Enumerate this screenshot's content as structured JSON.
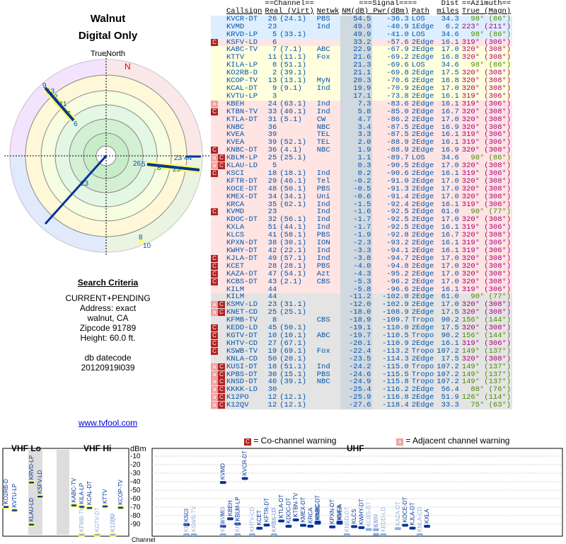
{
  "title": "Walnut",
  "subtitle": "Digital Only",
  "north_label": "TrueNorth",
  "magnetic_label": "N",
  "criteria": {
    "heading": "Search Criteria",
    "lines": [
      "CURRENT+PENDING",
      "Address: exact",
      "walnut, CA",
      "Zipcode 91789",
      "Height: 60.0 ft.",
      "",
      "db datecode",
      "20120919l039"
    ]
  },
  "site_link": "www.tvfool.com",
  "table": {
    "header1": [
      "",
      "==Channel==",
      "",
      "===Signal====",
      "",
      "Dist",
      "==Azimuth=="
    ],
    "header2": [
      "Callsign",
      "Real (Virt)",
      "Netwk",
      "NM(dB) Pwr(dBm)",
      "Path",
      "miles",
      "True (Magn)"
    ],
    "rows": [
      {
        "m": "",
        "cs": "KVCR-DT",
        "rc": "26",
        "vc": "(24.1)",
        "net": "PBS",
        "nm": "54.5",
        "pwr": "-36.3",
        "path": "LOS",
        "dist": "34.3",
        "az": "98° (86°)",
        "bg": "#ddeeff",
        "azc": "green"
      },
      {
        "m": "",
        "cs": "KVMD",
        "rc": "23",
        "vc": "",
        "net": "Ind",
        "nm": "49.9",
        "pwr": "-40.9",
        "path": "1Edge",
        "dist": "6.2",
        "az": "223° (211°)",
        "bg": "#ddeeff",
        "azc": "purple"
      },
      {
        "m": "",
        "cs": "KRVD-LP",
        "rc": "5",
        "vc": "(33.1)",
        "net": "",
        "nm": "49.9",
        "pwr": "-41.0",
        "path": "LOS",
        "dist": "34.6",
        "az": "98° (86°)",
        "bg": "#ddeeff",
        "azc": "green"
      },
      {
        "m": "C",
        "cs": "KSFV-LD",
        "rc": "6",
        "vc": "",
        "net": "",
        "nm": "33.2",
        "pwr": "-57.6",
        "path": "2Edge",
        "dist": "16.1",
        "az": "319° (306°)",
        "bg": "#ffe4e4",
        "azc": "purple"
      },
      {
        "m": "",
        "cs": "KABC-TV",
        "rc": "7",
        "vc": "(7.1)",
        "net": "ABC",
        "nm": "22.9",
        "pwr": "-67.9",
        "path": "2Edge",
        "dist": "17.0",
        "az": "320° (308°)",
        "bg": "#ffffdd",
        "azc": "purple"
      },
      {
        "m": "",
        "cs": "KTTV",
        "rc": "11",
        "vc": "(11.1)",
        "net": "Fox",
        "nm": "21.6",
        "pwr": "-69.2",
        "path": "2Edge",
        "dist": "16.8",
        "az": "320° (308°)",
        "bg": "#ffffdd",
        "azc": "purple"
      },
      {
        "m": "",
        "cs": "KILA-LP",
        "rc": "8",
        "vc": "(51.1)",
        "net": "",
        "nm": "21.3",
        "pwr": "-69.6",
        "path": "LOS",
        "dist": "34.6",
        "az": "98° (86°)",
        "bg": "#ffffdd",
        "azc": "green"
      },
      {
        "m": "",
        "cs": "KO2RB-D",
        "rc": "2",
        "vc": "(39.1)",
        "net": "",
        "nm": "21.1",
        "pwr": "-69.8",
        "path": "2Edge",
        "dist": "17.5",
        "az": "320° (308°)",
        "bg": "#ffffdd",
        "azc": "purple"
      },
      {
        "m": "",
        "cs": "KCOP-TV",
        "rc": "13",
        "vc": "(13.1)",
        "net": "MyN",
        "nm": "20.3",
        "pwr": "-70.6",
        "path": "2Edge",
        "dist": "16.8",
        "az": "320° (308°)",
        "bg": "#ffffdd",
        "azc": "purple"
      },
      {
        "m": "",
        "cs": "KCAL-DT",
        "rc": "9",
        "vc": "(9.1)",
        "net": "Ind",
        "nm": "19.9",
        "pwr": "-70.9",
        "path": "2Edge",
        "dist": "17.0",
        "az": "320° (308°)",
        "bg": "#ffffdd",
        "azc": "purple"
      },
      {
        "m": "",
        "cs": "KVTU-LP",
        "rc": "3",
        "vc": "",
        "net": "",
        "nm": "17.1",
        "pwr": "-73.8",
        "path": "2Edge",
        "dist": "16.1",
        "az": "319° (306°)",
        "bg": "#ffffdd",
        "azc": "purple"
      },
      {
        "m": "a",
        "cs": "KBEH",
        "rc": "24",
        "vc": "(63.1)",
        "net": "Ind",
        "nm": "7.3",
        "pwr": "-83.6",
        "path": "2Edge",
        "dist": "16.1",
        "az": "319° (306°)",
        "bg": "#ffe4e4",
        "azc": "purple"
      },
      {
        "m": "C",
        "cs": "KTBN-TV",
        "rc": "33",
        "vc": "(40.1)",
        "net": "Ind",
        "nm": "5.8",
        "pwr": "-85.0",
        "path": "2Edge",
        "dist": "16.7",
        "az": "320° (308°)",
        "bg": "#ffe4e4",
        "azc": "purple"
      },
      {
        "m": "",
        "cs": "KTLA-DT",
        "rc": "31",
        "vc": "(5.1)",
        "net": "CW",
        "nm": "4.7",
        "pwr": "-86.2",
        "path": "2Edge",
        "dist": "17.0",
        "az": "320° (308°)",
        "bg": "#ffe4e4",
        "azc": "purple"
      },
      {
        "m": "",
        "cs": "KNBC",
        "rc": "36",
        "vc": "",
        "net": "NBC",
        "nm": "3.4",
        "pwr": "-87.5",
        "path": "2Edge",
        "dist": "16.9",
        "az": "320° (308°)",
        "bg": "#ffe4e4",
        "azc": "purple"
      },
      {
        "m": "",
        "cs": "KVEA",
        "rc": "39",
        "vc": "",
        "net": "TEL",
        "nm": "3.3",
        "pwr": "-87.5",
        "path": "2Edge",
        "dist": "16.1",
        "az": "319° (306°)",
        "bg": "#ffe4e4",
        "azc": "purple"
      },
      {
        "m": "",
        "cs": "KVEA",
        "rc": "39",
        "vc": "(52.1)",
        "net": "TEL",
        "nm": "2.0",
        "pwr": "-88.9",
        "path": "2Edge",
        "dist": "16.1",
        "az": "319° (306°)",
        "bg": "#ffe4e4",
        "azc": "purple"
      },
      {
        "m": "C",
        "cs": "KNBC-DT",
        "rc": "36",
        "vc": "(4.1)",
        "net": "NBC",
        "nm": "1.9",
        "pwr": "-88.9",
        "path": "2Edge",
        "dist": "16.9",
        "az": "320° (308°)",
        "bg": "#ffe4e4",
        "azc": "purple"
      },
      {
        "m": "aC",
        "cs": "KBLM-LP",
        "rc": "25",
        "vc": "(25.1)",
        "net": "",
        "nm": "1.1",
        "pwr": "-89.7",
        "path": "LOS",
        "dist": "34.6",
        "az": "98° (86°)",
        "bg": "#ffe4e4",
        "azc": "green"
      },
      {
        "m": "aC",
        "cs": "KLAU-LD",
        "rc": "5",
        "vc": "",
        "net": "",
        "nm": "0.3",
        "pwr": "-90.5",
        "path": "2Edge",
        "dist": "17.0",
        "az": "320° (308°)",
        "bg": "#ffe4e4",
        "azc": "purple"
      },
      {
        "m": "C",
        "cs": "KSCI",
        "rc": "18",
        "vc": "(18.1)",
        "net": "Ind",
        "nm": "0.2",
        "pwr": "-90.6",
        "path": "2Edge",
        "dist": "16.1",
        "az": "319° (306°)",
        "bg": "#ffe4e4",
        "azc": "purple"
      },
      {
        "m": "",
        "cs": "KFTR-DT",
        "rc": "29",
        "vc": "(46.1)",
        "net": "Tel",
        "nm": "-0.2",
        "pwr": "-91.0",
        "path": "2Edge",
        "dist": "17.0",
        "az": "320° (308°)",
        "bg": "#ffe4e4",
        "azc": "purple"
      },
      {
        "m": "",
        "cs": "KOCE-DT",
        "rc": "48",
        "vc": "(50.1)",
        "net": "PBS",
        "nm": "-0.5",
        "pwr": "-91.3",
        "path": "2Edge",
        "dist": "17.0",
        "az": "320° (308°)",
        "bg": "#ffe4e4",
        "azc": "purple"
      },
      {
        "m": "",
        "cs": "KMEX-DT",
        "rc": "34",
        "vc": "(34.1)",
        "net": "Uni",
        "nm": "-0.6",
        "pwr": "-91.4",
        "path": "2Edge",
        "dist": "17.0",
        "az": "320° (308°)",
        "bg": "#ffe4e4",
        "azc": "purple"
      },
      {
        "m": "",
        "cs": "KRCA",
        "rc": "35",
        "vc": "(62.1)",
        "net": "Ind",
        "nm": "-1.5",
        "pwr": "-92.4",
        "path": "2Edge",
        "dist": "16.1",
        "az": "319° (306°)",
        "bg": "#ffe4e4",
        "azc": "purple"
      },
      {
        "m": "C",
        "cs": "KVMD",
        "rc": "23",
        "vc": "",
        "net": "Ind",
        "nm": "-1.6",
        "pwr": "-92.5",
        "path": "2Edge",
        "dist": "61.0",
        "az": "90° (77°)",
        "bg": "#ffe4e4",
        "azc": "green"
      },
      {
        "m": "",
        "cs": "KDOC-DT",
        "rc": "32",
        "vc": "(56.1)",
        "net": "Ind",
        "nm": "-1.7",
        "pwr": "-92.5",
        "path": "2Edge",
        "dist": "17.0",
        "az": "320° (308°)",
        "bg": "#ffe4e4",
        "azc": "purple"
      },
      {
        "m": "",
        "cs": "KXLA",
        "rc": "51",
        "vc": "(44.1)",
        "net": "Ind",
        "nm": "-1.7",
        "pwr": "-92.5",
        "path": "2Edge",
        "dist": "16.1",
        "az": "319° (306°)",
        "bg": "#ffe4e4",
        "azc": "purple"
      },
      {
        "m": "",
        "cs": "KLCS",
        "rc": "41",
        "vc": "(58.1)",
        "net": "PBS",
        "nm": "-1.9",
        "pwr": "-92.8",
        "path": "2Edge",
        "dist": "16.7",
        "az": "320° (308°)",
        "bg": "#ffe4e4",
        "azc": "purple"
      },
      {
        "m": "",
        "cs": "KPXN-DT",
        "rc": "38",
        "vc": "(30.1)",
        "net": "ION",
        "nm": "-2.3",
        "pwr": "-93.2",
        "path": "2Edge",
        "dist": "16.1",
        "az": "319° (306°)",
        "bg": "#ffe4e4",
        "azc": "purple"
      },
      {
        "m": "",
        "cs": "KWHY-DT",
        "rc": "42",
        "vc": "(22.1)",
        "net": "Ind",
        "nm": "-3.3",
        "pwr": "-94.1",
        "path": "2Edge",
        "dist": "16.1",
        "az": "319° (306°)",
        "bg": "#ffe4e4",
        "azc": "purple"
      },
      {
        "m": "C",
        "cs": "KJLA-DT",
        "rc": "49",
        "vc": "(57.1)",
        "net": "Ind",
        "nm": "-3.8",
        "pwr": "-94.7",
        "path": "2Edge",
        "dist": "17.0",
        "az": "320° (308°)",
        "bg": "#ffe4e4",
        "azc": "purple"
      },
      {
        "m": "C",
        "cs": "KCET",
        "rc": "28",
        "vc": "(28.1)",
        "net": "PBS",
        "nm": "-4.0",
        "pwr": "-94.8",
        "path": "2Edge",
        "dist": "17.0",
        "az": "320° (308°)",
        "bg": "#ffe4e4",
        "azc": "purple"
      },
      {
        "m": "C",
        "cs": "KAZA-DT",
        "rc": "47",
        "vc": "(54.1)",
        "net": "Azt",
        "nm": "-4.3",
        "pwr": "-95.2",
        "path": "2Edge",
        "dist": "17.0",
        "az": "320° (308°)",
        "bg": "#ffe4e4",
        "azc": "purple"
      },
      {
        "m": "C",
        "cs": "KCBS-DT",
        "rc": "43",
        "vc": "(2.1)",
        "net": "CBS",
        "nm": "-5.3",
        "pwr": "-96.2",
        "path": "2Edge",
        "dist": "17.0",
        "az": "320° (308°)",
        "bg": "#ffe4e4",
        "azc": "purple"
      },
      {
        "m": "",
        "cs": "KILM",
        "rc": "44",
        "vc": "",
        "net": "",
        "nm": "-5.8",
        "pwr": "-96.6",
        "path": "2Edge",
        "dist": "16.1",
        "az": "319° (306°)",
        "bg": "#ffe4e4",
        "azc": "purple"
      },
      {
        "m": "",
        "cs": "KILM",
        "rc": "44",
        "vc": "",
        "net": "",
        "nm": "-11.2",
        "pwr": "-102.0",
        "path": "2Edge",
        "dist": "61.0",
        "az": "90° (77°)",
        "bg": "#e4e4e4",
        "azc": "green"
      },
      {
        "m": "aC",
        "cs": "KSMV-LD",
        "rc": "23",
        "vc": "(31.1)",
        "net": "",
        "nm": "-12.0",
        "pwr": "-102.9",
        "path": "2Edge",
        "dist": "17.0",
        "az": "320° (308°)",
        "bg": "#e4e4e4",
        "azc": "purple"
      },
      {
        "m": "aC",
        "cs": "KNET-CD",
        "rc": "25",
        "vc": "(25.1)",
        "net": "",
        "nm": "-18.0",
        "pwr": "-108.9",
        "path": "2Edge",
        "dist": "17.5",
        "az": "320° (308°)",
        "bg": "#e4e4e4",
        "azc": "purple"
      },
      {
        "m": "",
        "cs": "KFMB-TV",
        "rc": "8",
        "vc": "",
        "net": "CBS",
        "nm": "-18.9",
        "pwr": "-109.7",
        "path": "Tropo",
        "dist": "90.2",
        "az": "156° (144°)",
        "bg": "#e4e4e4",
        "azc": "green"
      },
      {
        "m": "C",
        "cs": "KEDD-LD",
        "rc": "45",
        "vc": "(50.1)",
        "net": "",
        "nm": "-19.1",
        "pwr": "-110.0",
        "path": "2Edge",
        "dist": "17.5",
        "az": "320° (308°)",
        "bg": "#e4e4e4",
        "azc": "purple"
      },
      {
        "m": "C",
        "cs": "KGTV-DT",
        "rc": "10",
        "vc": "(10.1)",
        "net": "ABC",
        "nm": "-19.7",
        "pwr": "-110.5",
        "path": "Tropo",
        "dist": "90.2",
        "az": "156° (144°)",
        "bg": "#e4e4e4",
        "azc": "green"
      },
      {
        "m": "C",
        "cs": "KHTV-CD",
        "rc": "27",
        "vc": "(67.1)",
        "net": "",
        "nm": "-20.1",
        "pwr": "-110.9",
        "path": "2Edge",
        "dist": "16.1",
        "az": "319° (306°)",
        "bg": "#e4e4e4",
        "azc": "purple"
      },
      {
        "m": "C",
        "cs": "KSWB-TV",
        "rc": "19",
        "vc": "(69.1)",
        "net": "Fox",
        "nm": "-22.4",
        "pwr": "-113.2",
        "path": "Tropo",
        "dist": "107.2",
        "az": "149° (137°)",
        "bg": "#e4e4e4",
        "azc": "green"
      },
      {
        "m": "",
        "cs": "KNLA-CD",
        "rc": "50",
        "vc": "(20.1)",
        "net": "",
        "nm": "-23.5",
        "pwr": "-114.3",
        "path": "2Edge",
        "dist": "17.5",
        "az": "320° (308°)",
        "bg": "#e4e4e4",
        "azc": "purple"
      },
      {
        "m": "aC",
        "cs": "KUSI-DT",
        "rc": "18",
        "vc": "(51.1)",
        "net": "Ind",
        "nm": "-24.2",
        "pwr": "-115.0",
        "path": "Tropo",
        "dist": "107.2",
        "az": "149° (137°)",
        "bg": "#e4e4e4",
        "azc": "green"
      },
      {
        "m": "aC",
        "cs": "KPBS-DT",
        "rc": "30",
        "vc": "(15.1)",
        "net": "PBS",
        "nm": "-24.6",
        "pwr": "-115.5",
        "path": "Tropo",
        "dist": "107.2",
        "az": "149° (137°)",
        "bg": "#e4e4e4",
        "azc": "green"
      },
      {
        "m": "aC",
        "cs": "KNSD-DT",
        "rc": "40",
        "vc": "(39.1)",
        "net": "NBC",
        "nm": "-24.9",
        "pwr": "-115.8",
        "path": "Tropo",
        "dist": "107.2",
        "az": "149° (137°)",
        "bg": "#e4e4e4",
        "azc": "green"
      },
      {
        "m": "aC",
        "cs": "KKKK-LD",
        "rc": "30",
        "vc": "",
        "net": "",
        "nm": "-25.4",
        "pwr": "-116.2",
        "path": "2Edge",
        "dist": "56.4",
        "az": "88° (76°)",
        "bg": "#e4e4e4",
        "azc": "green"
      },
      {
        "m": "aC",
        "cs": "K12PO",
        "rc": "12",
        "vc": "(12.1)",
        "net": "",
        "nm": "-25.9",
        "pwr": "-116.8",
        "path": "2Edge",
        "dist": "51.9",
        "az": "126° (114°)",
        "bg": "#e4e4e4",
        "azc": "green"
      },
      {
        "m": "aC",
        "cs": "K12QV",
        "rc": "12",
        "vc": "(12.1)",
        "net": "",
        "nm": "-27.6",
        "pwr": "-118.4",
        "path": "2Edge",
        "dist": "33.3",
        "az": "75° (63°)",
        "bg": "#e4e4e4",
        "azc": "green"
      }
    ]
  },
  "legend": {
    "co_channel": "= Co-channel warning",
    "adjacent": "= Adjacent channel warning",
    "co_mark": "C",
    "adj_mark": "a"
  },
  "spectrum": {
    "vhf_lo": "VHF Lo",
    "vhf_hi": "VHF Hi",
    "uhf": "UHF",
    "unit": "dBm",
    "channel_label": "Channel",
    "yticks": [
      "-10",
      "-20",
      "-30",
      "-40",
      "-50",
      "-60",
      "-70",
      "-80",
      "-90"
    ]
  }
}
